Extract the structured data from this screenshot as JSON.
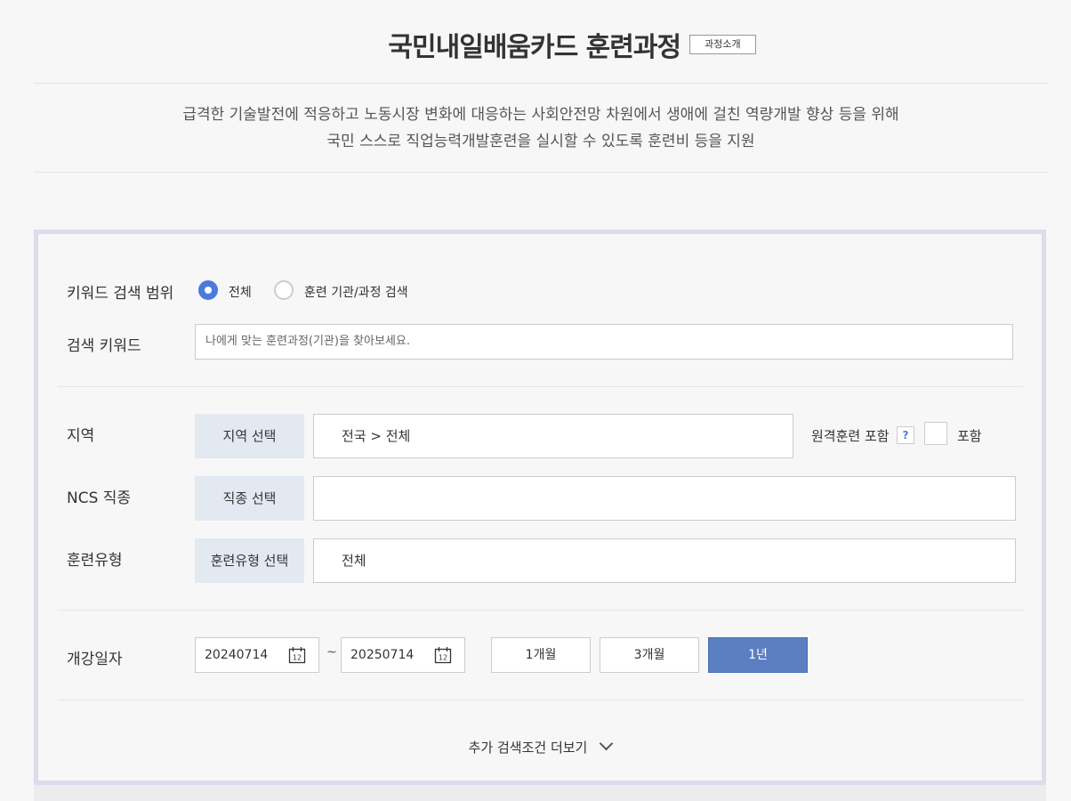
{
  "header": {
    "title": "국민내일배움카드 훈련과정",
    "intro_button": "과정소개",
    "desc_line1": "급격한 기술발전에 적응하고 노동시장 변화에 대응하는 사회안전망 차원에서 생애에 걸친 역량개발 향상 등을 위해",
    "desc_line2": "국민 스스로 직업능력개발훈련을 실시할 수 있도록 훈련비 등을 지원"
  },
  "search": {
    "scope_label": "키워드 검색 범위",
    "scope_options": [
      "전체",
      "훈련 기관/과정 검색"
    ],
    "scope_selected": "전체",
    "keyword_label": "검색 키워드",
    "keyword_placeholder": "나에게 맞는 훈련과정(기관)을 찾아보세요.",
    "keyword_value": ""
  },
  "filters": {
    "region_label": "지역",
    "region_button": "지역 선택",
    "region_value": "전국 > 전체",
    "remote_label": "원격훈련 포함",
    "remote_help": "?",
    "remote_check_label": "포함",
    "remote_checked": false,
    "ncs_label": "NCS 직종",
    "ncs_button": "직종 선택",
    "ncs_value": "",
    "type_label": "훈련유형",
    "type_button": "훈련유형 선택",
    "type_value": "전체"
  },
  "dates": {
    "label": "개강일자",
    "start": "20240714",
    "end": "20250714",
    "separator": "~",
    "calendar_icon_text": "12",
    "periods": [
      "1개월",
      "3개월",
      "1년"
    ],
    "active_period": "1년"
  },
  "more_label": "추가 검색조건 더보기",
  "colors": {
    "accent": "#4a7bdc",
    "active_button": "#5b7fc1",
    "select_button_bg": "#e3e9f1",
    "panel_border": "#dcdcec"
  }
}
